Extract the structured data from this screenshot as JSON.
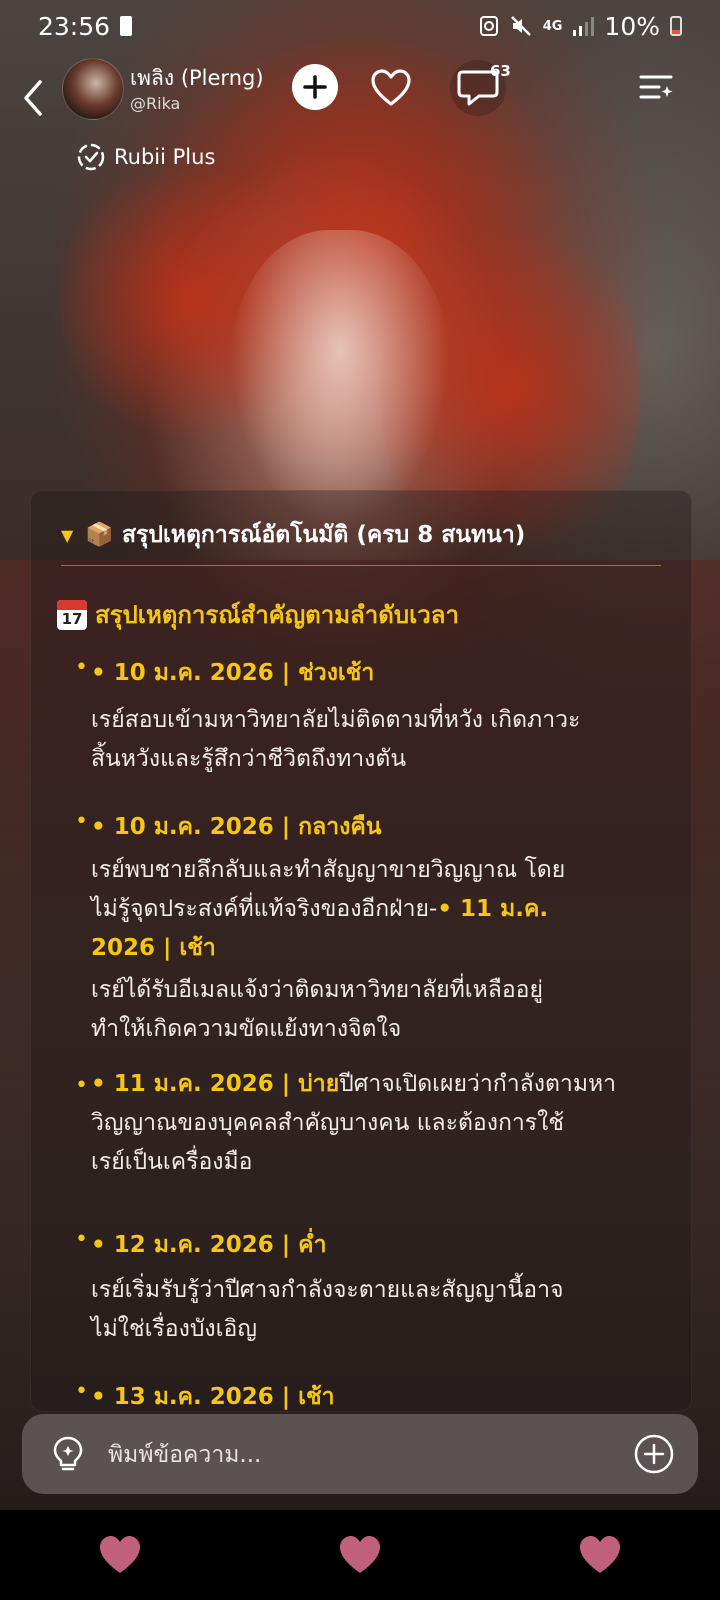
{
  "status_bar": {
    "time": "23:56",
    "network": "4G",
    "battery": "10%"
  },
  "header": {
    "name": "เพลิง (Plerng)",
    "handle": "@Rika",
    "comment_count": "63",
    "badge_label": "Rubii Plus"
  },
  "summary": {
    "title": "📦 สรุปเหตุการณ์อัตโนมัติ (ครบ 8 สนทนา)",
    "section_title": "สรุปเหตุการณ์สำคัญตามลำดับเวลา",
    "calendar_month": "JUL",
    "calendar_day": "17",
    "entries": [
      {
        "date": "• 10 ม.ค. 2026 | ช่วงเช้า",
        "line1": "เรย์สอบเข้ามหาวิทยาลัยไม่ติดตามที่หวัง เกิดภาวะ",
        "line2": "สิ้นหวังและรู้สึกว่าชีวิตถึงทางตัน"
      },
      {
        "date": "• 10 ม.ค. 2026 | กลางคืน",
        "line1": "เรย์พบชายลึกลับและทำสัญญาขายวิญญาณ โดย",
        "line2_text": "ไม่รู้จุดประสงค์ที่แท้จริงของอีกฝ่าย-",
        "line2_date": "• 11 ม.ค.",
        "line3_date": "2026 | เช้า",
        "line4": "เรย์ได้รับอีเมลแจ้งว่าติดมหาวิทยาลัยที่เหลืออยู่",
        "line5": "ทำให้เกิดความขัดแย้งทางจิตใจ"
      },
      {
        "date": "• 11 ม.ค. 2026 | บ่าย",
        "line1_text": "ปีศาจเปิดเผยว่ากำลังตามหา",
        "line2": "วิญญาณของบุคคลสำคัญบางคน และต้องการใช้",
        "line3": "เรย์เป็นเครื่องมือ"
      },
      {
        "date": "• 12 ม.ค. 2026 | ค่ำ",
        "line1": "เรย์เริ่มรับรู้ว่าปีศาจกำลังจะตายและสัญญานี้อาจ",
        "line2": "ไม่ใช่เรื่องบังเอิญ"
      },
      {
        "date": "• 13 ม.ค. 2026 | เช้า"
      }
    ]
  },
  "composer": {
    "placeholder": "พิมพ์ข้อความ..."
  },
  "colors": {
    "accent": "#f5c518",
    "nav_heart": "#c0607c"
  }
}
